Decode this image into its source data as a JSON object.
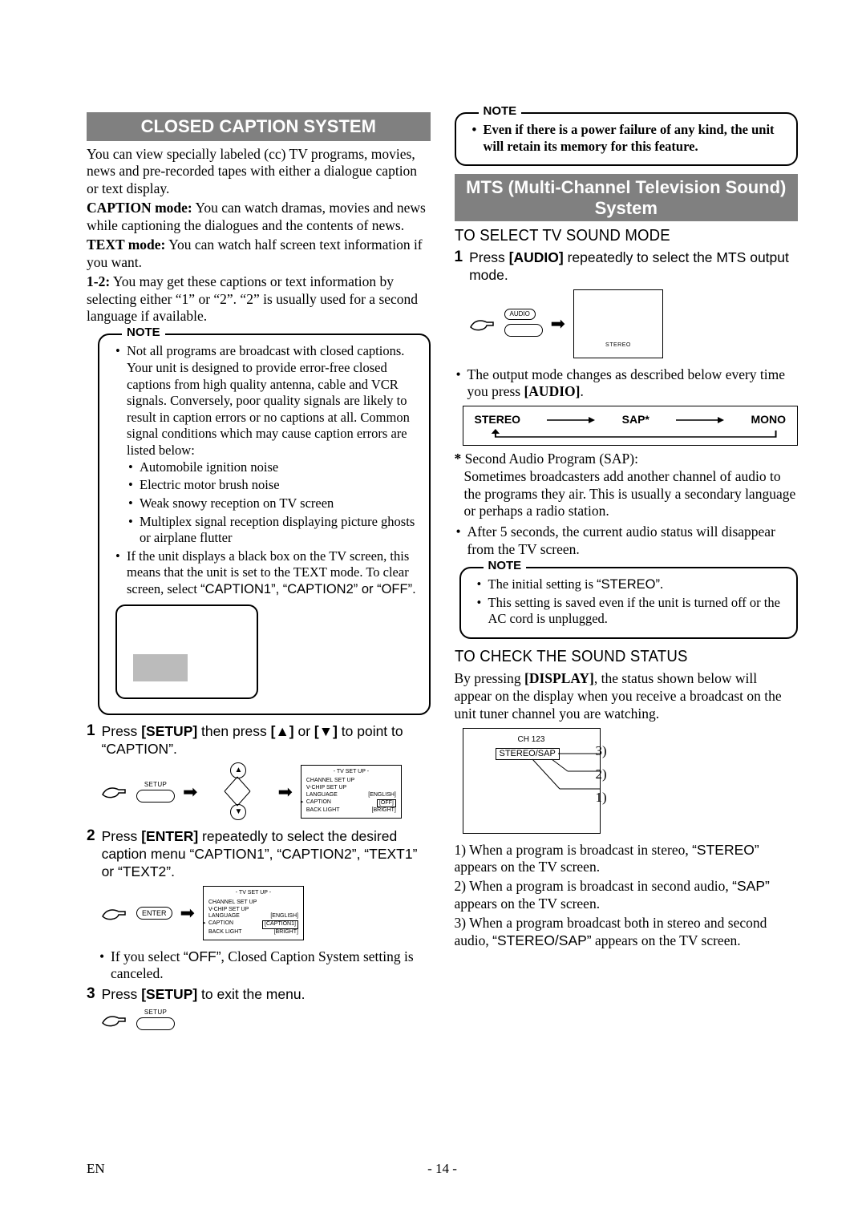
{
  "left": {
    "section_title": "CLOSED CAPTION SYSTEM",
    "intro": "You can view specially labeled (cc) TV programs, movies, news and pre-recorded tapes with either a dialogue caption or text display.",
    "caption_mode_label": "CAPTION mode:",
    "caption_mode_text": " You can watch dramas, movies and news while captioning the dialogues and the contents of news.",
    "text_mode_label": "TEXT mode:",
    "text_mode_text": " You can watch half screen text information if you want.",
    "item12_label": "1-2:",
    "item12_text": " You may get these captions or text information by selecting either “1” or “2”. “2” is usually used for a second language if available.",
    "note_label": "NOTE",
    "note1_li1": "Not all programs are broadcast with closed captions. Your unit is designed to provide error-free closed captions from high quality antenna, cable and VCR signals. Conversely, poor quality signals are likely to result in caption errors or no captions at all. Common signal conditions which may cause caption errors are listed below:",
    "note1_dash1": "Automobile ignition noise",
    "note1_dash2": "Electric motor brush noise",
    "note1_dash3": "Weak snowy reception on TV screen",
    "note1_dash4": "Multiplex signal reception displaying picture ghosts or airplane flutter",
    "note1_li2_pre": "If the unit displays a black box on the TV screen, this means that the unit is set to the TEXT mode. To clear screen, select ",
    "note1_li2_suf": "“CAPTION1”, “CAPTION2” or “OFF”.",
    "steps": {
      "s1_pre": "Press ",
      "s1_b1": "[SETUP]",
      "s1_mid": " then press ",
      "s1_b2": "[▲]",
      "s1_or": " or ",
      "s1_b3": "[▼]",
      "s1_post": " to point to “CAPTION”.",
      "s2_pre": "Press ",
      "s2_b1": "[ENTER]",
      "s2_post": " repeatedly to select the desired caption menu “CAPTION1”, “CAPTION2”, “TEXT1” or “TEXT2”.",
      "s2_note_pre": "If you select ",
      "s2_note_off": "“OFF”",
      "s2_note_post": ", Closed Caption System setting is canceled.",
      "s3_pre": "Press ",
      "s3_b1": "[SETUP]",
      "s3_post": " to exit the menu."
    },
    "tvmenu": {
      "title": "- TV SET UP -",
      "r1": "CHANNEL SET UP",
      "r2": "V-CHIP SET UP",
      "r3l": "LANGUAGE",
      "r3v_en": "[ENGLISH]",
      "r4l": "CAPTION",
      "r4v_off": "[OFF]",
      "r4v_cap1": "[CAPTION1]",
      "r5l": "BACK LIGHT",
      "r5v": "[BRIGHT]"
    },
    "btn_setup": "SETUP",
    "btn_enter": "ENTER",
    "btn_audio": "AUDIO"
  },
  "right": {
    "note_label": "NOTE",
    "top_note": "Even if there is a power failure of any kind, the unit will retain its memory for this feature.",
    "section_title": "MTS (Multi-Channel Television Sound) System",
    "sub1": "TO SELECT TV SOUND MODE",
    "step1_pre": "Press ",
    "step1_b": "[AUDIO]",
    "step1_post": " repeatedly to select the MTS output mode.",
    "stereo_lbl": "STEREO",
    "bullet_mode_pre": "The output mode changes as described below every time you press ",
    "bullet_mode_b": "[AUDIO]",
    "bullet_mode_post": ".",
    "cycle": {
      "a": "STEREO",
      "b": "SAP*",
      "c": "MONO"
    },
    "sap_star": "*",
    "sap_title": "Second Audio Program (SAP):",
    "sap_text": "Sometimes broadcasters add another channel of audio to the programs they air. This is usually a secondary language or perhaps a radio station.",
    "bullet_5s": "After 5 seconds, the current audio status will disappear from the TV screen.",
    "note2_li1_pre": "The initial setting is ",
    "note2_li1_val": "“STEREO”",
    "note2_li1_post": ".",
    "note2_li2": "This setting is saved even if the unit is turned off or the AC cord is unplugged.",
    "sub2": "TO CHECK THE SOUND STATUS",
    "check_intro_pre": "By pressing ",
    "check_intro_b": "[DISPLAY]",
    "check_intro_post": ", the status shown below will appear on the display when you receive a broadcast on the unit tuner channel you are watching.",
    "screen": {
      "ch": "CH 123",
      "ssap": "STEREO/SAP",
      "c1": "3)",
      "c2": "2)",
      "c3": "1)"
    },
    "list1_pre": "1) When a program is broadcast in stereo, ",
    "list1_val": "“STEREO”",
    "list1_post": " appears on the TV screen.",
    "list2_pre": "2) When a program is broadcast in second audio, ",
    "list2_val": "“SAP”",
    "list2_post": " appears on the TV screen.",
    "list3_pre": "3) When a program broadcast both in stereo and second audio, ",
    "list3_val": "“STEREO/SAP”",
    "list3_post": " appears on the TV screen."
  },
  "footer": {
    "lang": "EN",
    "page": "- 14 -"
  }
}
